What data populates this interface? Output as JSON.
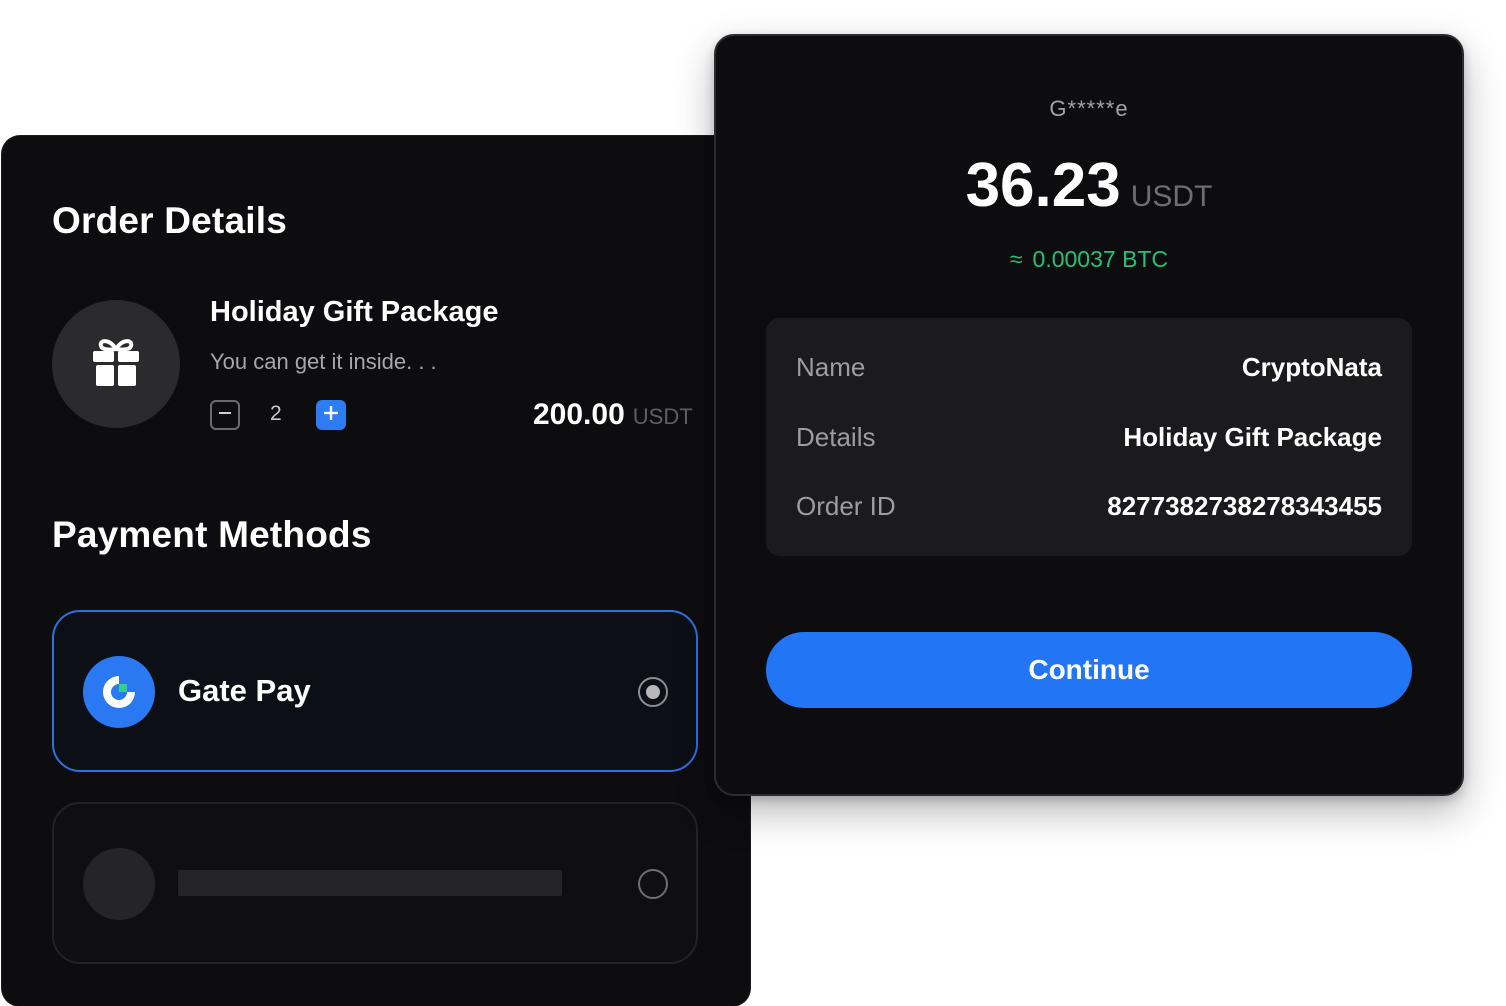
{
  "order": {
    "title": "Order Details",
    "product": {
      "icon": "gift-icon",
      "name": "Holiday Gift Package",
      "description": "You can get it inside. . .",
      "quantity": "2",
      "price": "200.00",
      "currency": "USDT"
    }
  },
  "payment": {
    "title": "Payment Methods",
    "methods": [
      {
        "label": "Gate Pay",
        "icon": "gate-pay-logo-icon",
        "selected": true
      },
      {
        "label": "",
        "icon": "placeholder-logo",
        "selected": false
      }
    ]
  },
  "confirm": {
    "merchant": "G*****e",
    "amount": "36.23",
    "currency": "USDT",
    "approx_symbol": "≈",
    "btc_value": "0.00037 BTC",
    "details": [
      {
        "key": "Name",
        "value": "CryptoNata"
      },
      {
        "key": "Details",
        "value": "Holiday Gift Package"
      },
      {
        "key": "Order ID",
        "value": "82773827382783434​55"
      }
    ],
    "continue_label": "Continue"
  },
  "colors": {
    "accent": "#2275f5",
    "btc_green": "#23c078",
    "card_bg": "#0d0d10"
  }
}
